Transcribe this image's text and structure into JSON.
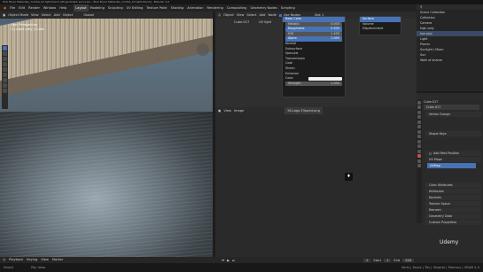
{
  "window_title": "Hub Bryer Materials_Yumtal_Sd light.blend (\\Projects\\slik services\\...\\Hub Bryer Materials_Yumtal_Sd light.blend) - Blender 4.0",
  "menu": [
    "File",
    "Edit",
    "Render",
    "Window",
    "Help"
  ],
  "workspace_tabs": [
    "Layout",
    "Modeling",
    "Sculpting",
    "UV Editing",
    "Texture Paint",
    "Shading",
    "Animation",
    "Rendering",
    "Compositing",
    "Geometry Nodes",
    "Scripting"
  ],
  "active_workspace": "Layout",
  "scene_label": "Scene",
  "view_layer_label": "ViewLayer",
  "viewport": {
    "mode": "Object Mode",
    "header_items": [
      "View",
      "Select",
      "Add",
      "Object"
    ],
    "transform": "Global",
    "overlay_text_1": "User Perspective",
    "overlay_text_2": "(1) Light prey | Cubic"
  },
  "node_editor": {
    "header_items": [
      "Object",
      "View",
      "Select",
      "Add",
      "Node"
    ],
    "use_nodes": "Use Nodes",
    "slot": "Slot 1",
    "material": "Cube.017",
    "uv_label": "UV light"
  },
  "dropdown": {
    "title": "Base Color",
    "fields": [
      {
        "label": "Metallic",
        "value": "0.000"
      },
      {
        "label": "Roughness",
        "value": "0.500"
      },
      {
        "label": "IOR",
        "value": "1.450"
      },
      {
        "label": "Alpha",
        "value": "1.000"
      }
    ],
    "items": [
      "Normal",
      "Subsurface",
      "Specular",
      "Transmission",
      "Coat",
      "Sheen",
      "Emission"
    ],
    "color_label": "Color",
    "strength_label": "Strength",
    "strength_value": "1.000"
  },
  "submenu": [
    "Surface",
    "Volume",
    "Displacement"
  ],
  "image_editor": {
    "header_items": [
      "View",
      "Image"
    ],
    "image_name": "5K-Logo-Flipped.png"
  },
  "outliner": {
    "header": "Scene Collection",
    "rows": [
      "Collection",
      "Camera",
      "high poly",
      "low poly",
      "Light",
      "Planes",
      "Sunlight / Moon",
      "Sun",
      "Walk of shame"
    ]
  },
  "properties": {
    "object_name": "Cube.017",
    "object_name_2": "Cube.017",
    "panels": [
      "Vertex Groups",
      "Shape Keys",
      "UV Maps",
      "Color Attributes",
      "Attributes",
      "Normals",
      "Texture Space",
      "Remesh",
      "Geometry Data",
      "Custom Properties"
    ],
    "uv_item": "UVMap",
    "add_rest": "Add Rest Position"
  },
  "timeline": {
    "items": [
      "Playback",
      "Keying",
      "View",
      "Marker"
    ],
    "frame": "1",
    "start_label": "Start",
    "start": "1",
    "end_label": "End",
    "end": "250"
  },
  "status": {
    "left": "Select",
    "middle": "Pan View",
    "right": "Verts | Faces | Tris | Objects | Memory | VRAM 4.0"
  },
  "watermark": "Udemy",
  "colors": {
    "accent": "#4772b3",
    "header": "#2b2b2b",
    "bg": "#1d1d1d",
    "active_tab": "#c1504c"
  }
}
